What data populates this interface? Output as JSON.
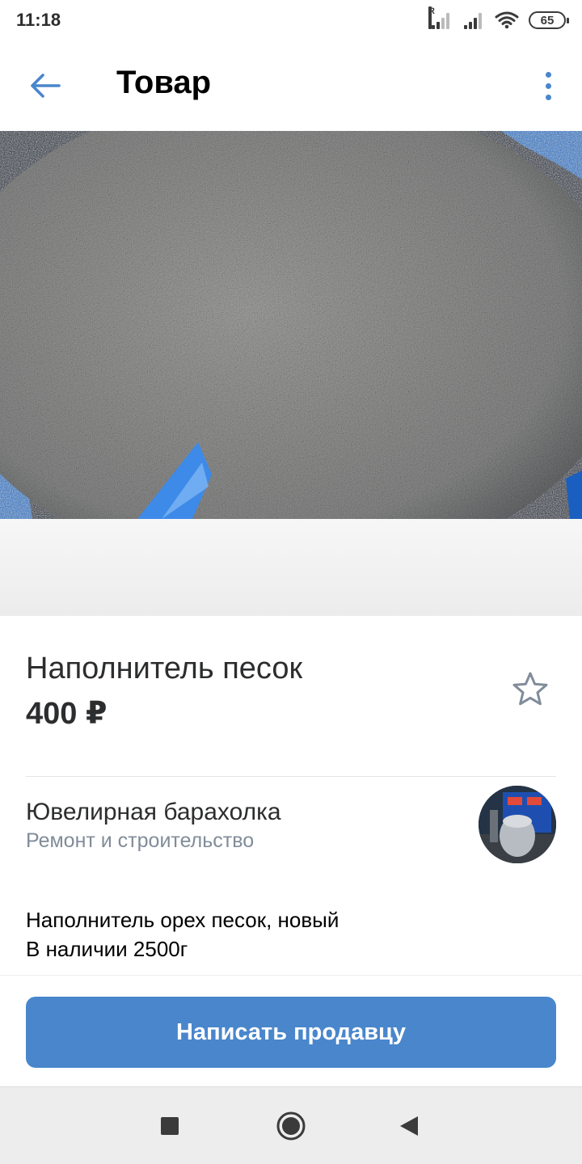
{
  "status_bar": {
    "time": "11:18",
    "roaming_label": "R",
    "battery_level": "65"
  },
  "header": {
    "title": "Товар",
    "back_icon": "arrow-left-icon",
    "more_icon": "more-vertical-icon"
  },
  "product": {
    "photo_subject": "sand",
    "title": "Наполнитель песок",
    "price": "400 ₽",
    "favorite_icon": "star-outline-icon"
  },
  "seller": {
    "name": "Ювелирная барахолка",
    "category": "Ремонт и строительство"
  },
  "description": {
    "lines": [
      "Наполнитель орех песок, новый",
      "В наличии 2500г"
    ]
  },
  "actions": {
    "write_seller_label": "Написать продавцу"
  },
  "nav_bar": {
    "recents_icon": "square-icon",
    "home_icon": "circle-icon",
    "back_icon": "triangle-back-icon"
  },
  "colors": {
    "accent": "#4986cc",
    "secondary_text": "#818c99",
    "primary_text": "#2c2d2e"
  }
}
